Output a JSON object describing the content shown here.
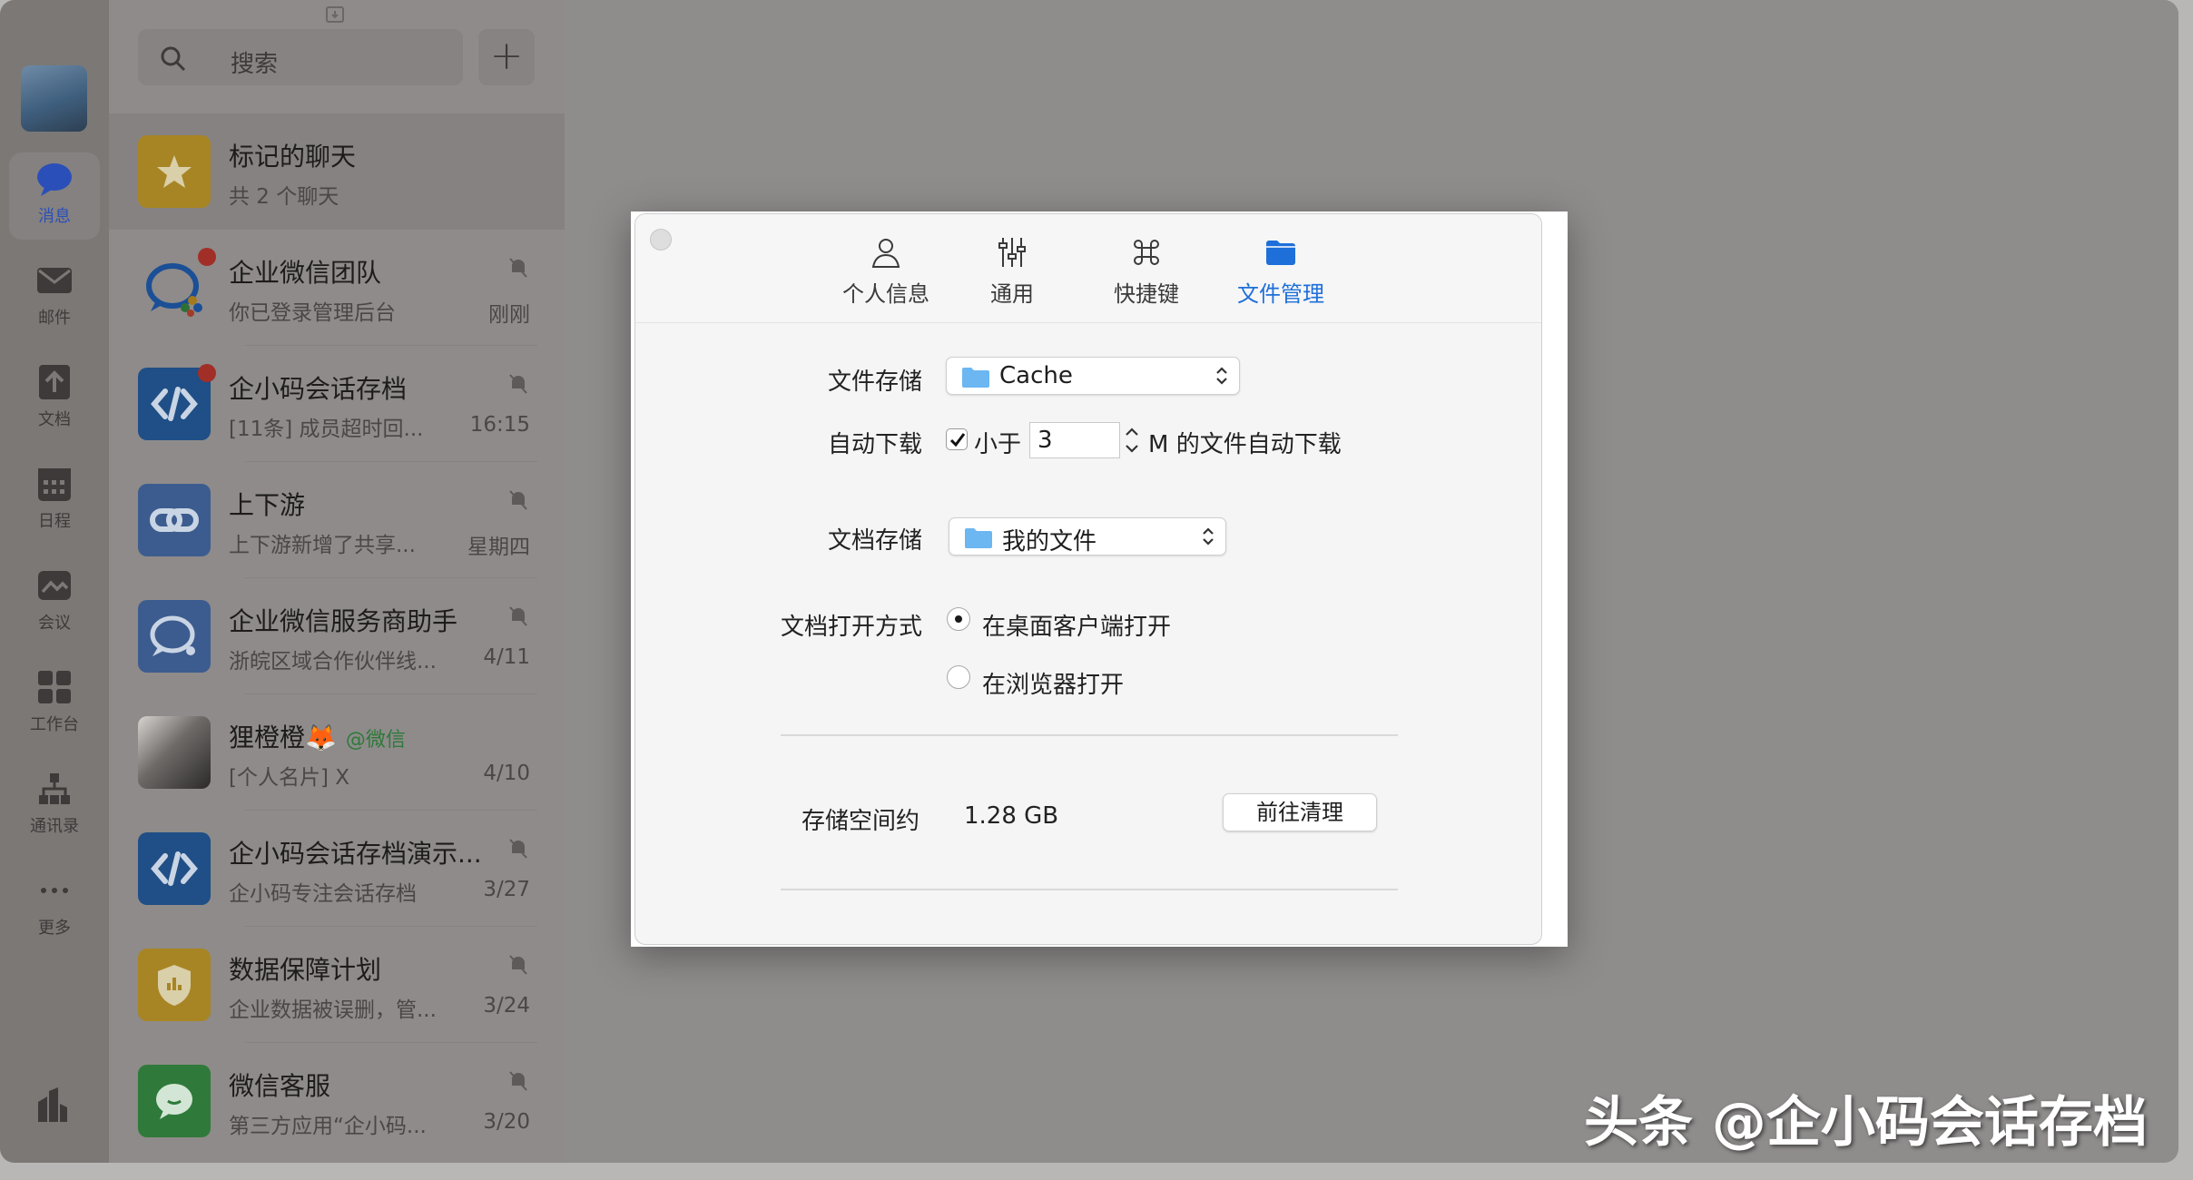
{
  "nav": {
    "items": [
      {
        "label": "消息",
        "icon": "chat-bubble-icon",
        "active": true
      },
      {
        "label": "邮件",
        "icon": "mail-icon"
      },
      {
        "label": "文档",
        "icon": "document-icon"
      },
      {
        "label": "日程",
        "icon": "calendar-icon"
      },
      {
        "label": "会议",
        "icon": "meeting-icon"
      },
      {
        "label": "工作台",
        "icon": "workbench-icon"
      },
      {
        "label": "通讯录",
        "icon": "contacts-icon"
      },
      {
        "label": "更多",
        "icon": "more-icon"
      }
    ]
  },
  "search": {
    "placeholder": "搜索"
  },
  "chats": [
    {
      "name": "标记的聊天",
      "sub": "共 2 个聊天",
      "time": "",
      "color": "#a88524"
    },
    {
      "name": "企业微信团队",
      "sub": "你已登录管理后台",
      "time": "刚刚",
      "unread": true
    },
    {
      "name": "企小码会话存档",
      "sub": "[11条] 成员超时回...",
      "time": "16:15",
      "unread": true,
      "color": "#1f4f86"
    },
    {
      "name": "上下游",
      "sub": "上下游新增了共享...",
      "time": "星期四",
      "color": "#3c5c8f"
    },
    {
      "name": "企业微信服务商助手",
      "sub": "浙皖区域合作伙伴线...",
      "time": "4/11",
      "color": "#3c5c8f"
    },
    {
      "name": "狸橙橙🦊",
      "tag": "@微信",
      "sub": "[个人名片] X",
      "time": "4/10"
    },
    {
      "name": "企小码会话存档演示...",
      "sub": "企小码专注会话存档",
      "time": "3/27",
      "color": "#1f4f86"
    },
    {
      "name": "数据保障计划",
      "sub": "企业数据被误删，管...",
      "time": "3/24",
      "color": "#a88524"
    },
    {
      "name": "微信客服",
      "sub": "第三方应用“企小码...",
      "time": "3/20",
      "color": "#2f7a3a"
    }
  ],
  "prefs": {
    "tabs": [
      {
        "label": "个人信息",
        "icon": "person-icon"
      },
      {
        "label": "通用",
        "icon": "sliders-icon"
      },
      {
        "label": "快捷键",
        "icon": "command-icon"
      },
      {
        "label": "文件管理",
        "icon": "folder-icon",
        "active": true
      }
    ],
    "file_storage_label": "文件存储",
    "file_storage_value": "Cache",
    "auto_download_label": "自动下载",
    "auto_download_less": "小于",
    "auto_download_size": "3",
    "auto_download_suffix": "M 的文件自动下载",
    "doc_storage_label": "文档存储",
    "doc_storage_value": "我的文件",
    "doc_open_label": "文档打开方式",
    "doc_open_desktop": "在桌面客户端打开",
    "doc_open_browser": "在浏览器打开",
    "storage_label": "存储空间约",
    "storage_value": "1.28 GB",
    "clean_button": "前往清理"
  },
  "watermark": "头条 @企小码会话存档",
  "accent_color": "#1e6fd9"
}
